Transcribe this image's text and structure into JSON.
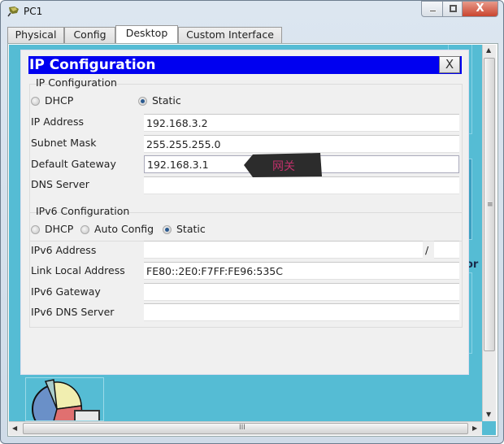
{
  "window": {
    "title": "PC1",
    "controls": {
      "minimize": "minimize",
      "maximize": "maximize",
      "close": "X"
    }
  },
  "tabs": [
    {
      "label": "Physical",
      "active": false
    },
    {
      "label": "Config",
      "active": false
    },
    {
      "label": "Desktop",
      "active": true
    },
    {
      "label": "Custom Interface",
      "active": false
    }
  ],
  "dialog": {
    "title": "IP Configuration",
    "close_label": "X",
    "ipv4": {
      "group_title": "IP Configuration",
      "modes": [
        {
          "label": "DHCP",
          "selected": false
        },
        {
          "label": "Static",
          "selected": true
        }
      ],
      "fields": [
        {
          "label": "IP Address",
          "value": "192.168.3.2"
        },
        {
          "label": "Subnet Mask",
          "value": "255.255.255.0"
        },
        {
          "label": "Default Gateway",
          "value": "192.168.3.1"
        },
        {
          "label": "DNS Server",
          "value": ""
        }
      ]
    },
    "ipv6": {
      "group_title": "IPv6 Configuration",
      "modes": [
        {
          "label": "DHCP",
          "selected": false
        },
        {
          "label": "Auto Config",
          "selected": false
        },
        {
          "label": "Static",
          "selected": true
        }
      ],
      "fields": [
        {
          "label": "IPv6 Address",
          "value": "",
          "prefix_separator": "/",
          "prefix_value": ""
        },
        {
          "label": "Link Local Address",
          "value": "FE80::2E0:F7FF:FE96:535C"
        },
        {
          "label": "IPv6 Gateway",
          "value": ""
        },
        {
          "label": "IPv6 DNS Server",
          "value": ""
        }
      ]
    }
  },
  "annotation": {
    "text": "网关"
  },
  "background": {
    "partial_text_1": ".",
    "partial_text_2": "or"
  },
  "scrollbars": {
    "h_grip": "III",
    "v_grip": "≡"
  }
}
